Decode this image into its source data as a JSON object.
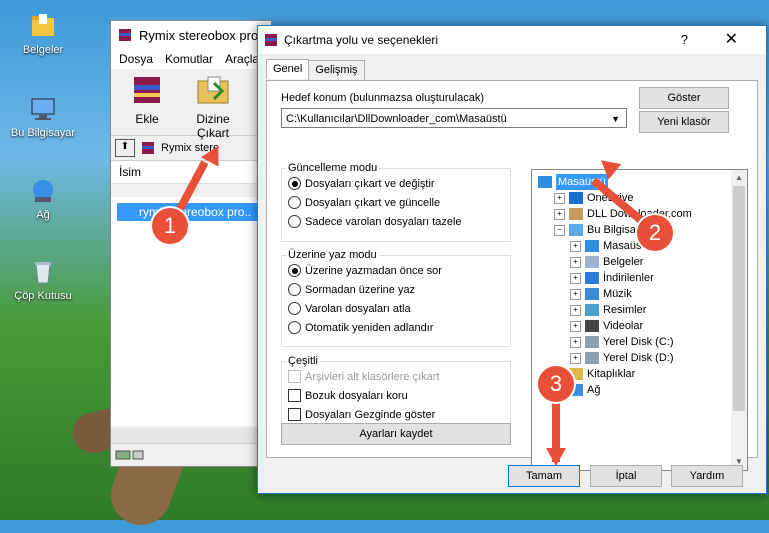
{
  "desktop": {
    "icons": [
      {
        "label": "Belgeler",
        "icon": "folder-icon"
      },
      {
        "label": "Bu Bilgisayar",
        "icon": "computer-icon"
      },
      {
        "label": "Ağ",
        "icon": "network-icon"
      },
      {
        "label": "Çöp Kutusu",
        "icon": "recycle-bin-icon"
      }
    ]
  },
  "winrar": {
    "title": "Rymix stereobox pro",
    "menu": [
      "Dosya",
      "Komutlar",
      "Araçla"
    ],
    "tools": [
      {
        "label": "Ekle",
        "icon": "add-archive-icon"
      },
      {
        "label": "Dizine Çıkart",
        "icon": "extract-to-icon"
      }
    ],
    "path": "Rymix stere",
    "list_header": "İsim",
    "list_items": [
      "rymix stereobox pro.."
    ]
  },
  "dialog": {
    "title": "Çıkartma yolu ve seçenekleri",
    "help": "?",
    "close": "✕",
    "tabs": [
      "Genel",
      "Gelişmiş"
    ],
    "dest_label": "Hedef konum (bulunmazsa oluşturulacak)",
    "dest_value": "C:\\Kullanıcılar\\DllDownloader_com\\Masaüstü",
    "show_button": "Göster",
    "new_folder_button": "Yeni klasör",
    "update_mode": {
      "legend": "Güncelleme modu",
      "options": [
        "Dosyaları çıkart ve değiştir",
        "Dosyaları çıkart ve güncelle",
        "Sadece varolan dosyaları tazele"
      ],
      "selected": 0
    },
    "overwrite_mode": {
      "legend": "Üzerine yaz modu",
      "options": [
        "Üzerine yazmadan önce sor",
        "Sormadan üzerine yaz",
        "Varolan dosyaları atla",
        "Otomatik yeniden adlandır"
      ],
      "selected": 0
    },
    "misc": {
      "legend": "Çeşitli",
      "options": [
        "Arşivleri alt klasörlere çıkart",
        "Bozuk dosyaları koru",
        "Dosyaları Gezginde göster"
      ]
    },
    "save_settings": "Ayarları kaydet",
    "tree": [
      {
        "label": "Masaüstü",
        "level": 0,
        "icon": "desktop-icon",
        "selected": true
      },
      {
        "label": "OneDrive",
        "level": 1,
        "icon": "onedrive-icon",
        "expand": "+"
      },
      {
        "label": "DLL Downloader.com",
        "level": 1,
        "icon": "user-icon",
        "expand": "+"
      },
      {
        "label": "Bu Bilgisayar",
        "level": 1,
        "icon": "computer-icon",
        "expand": "−"
      },
      {
        "label": "Masaüstü",
        "level": 2,
        "icon": "desktop-icon",
        "expand": "+"
      },
      {
        "label": "Belgeler",
        "level": 2,
        "icon": "documents-icon",
        "expand": "+"
      },
      {
        "label": "İndirilenler",
        "level": 2,
        "icon": "downloads-icon",
        "expand": "+"
      },
      {
        "label": "Müzik",
        "level": 2,
        "icon": "music-icon",
        "expand": "+"
      },
      {
        "label": "Resimler",
        "level": 2,
        "icon": "pictures-icon",
        "expand": "+"
      },
      {
        "label": "Videolar",
        "level": 2,
        "icon": "videos-icon",
        "expand": "+"
      },
      {
        "label": "Yerel Disk (C:)",
        "level": 2,
        "icon": "drive-icon",
        "expand": "+"
      },
      {
        "label": "Yerel Disk (D:)",
        "level": 2,
        "icon": "drive-icon",
        "expand": "+"
      },
      {
        "label": "Kitaplıklar",
        "level": 1,
        "icon": "libraries-icon",
        "expand": "+"
      },
      {
        "label": "Ağ",
        "level": 1,
        "icon": "network-icon",
        "expand": "+"
      }
    ],
    "ok": "Tamam",
    "cancel": "İptal",
    "help_button": "Yardım"
  },
  "annotations": [
    "1",
    "2",
    "3"
  ],
  "colors": {
    "accent": "#0078d7",
    "selection": "#3399ff",
    "annotation": "#e8503a"
  }
}
